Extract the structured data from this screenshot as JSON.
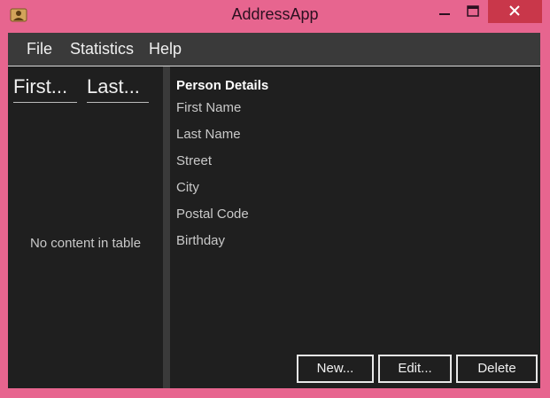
{
  "window": {
    "title": "AddressApp"
  },
  "menu": {
    "items": [
      "File",
      "Statistics",
      "Help"
    ]
  },
  "table": {
    "columns": [
      "First...",
      "Last..."
    ],
    "empty_message": "No content in table"
  },
  "details": {
    "title": "Person Details",
    "fields": [
      "First Name",
      "Last Name",
      "Street",
      "City",
      "Postal Code",
      "Birthday"
    ]
  },
  "buttons": {
    "new_label": "New...",
    "edit_label": "Edit...",
    "delete_label": "Delete"
  },
  "colors": {
    "frame": "#e7658f",
    "close": "#c9374a",
    "menubar": "#3a3a3a",
    "panel": "#1f1f1f",
    "text": "#f0f0f0",
    "muted_text": "#c9c9c9"
  }
}
